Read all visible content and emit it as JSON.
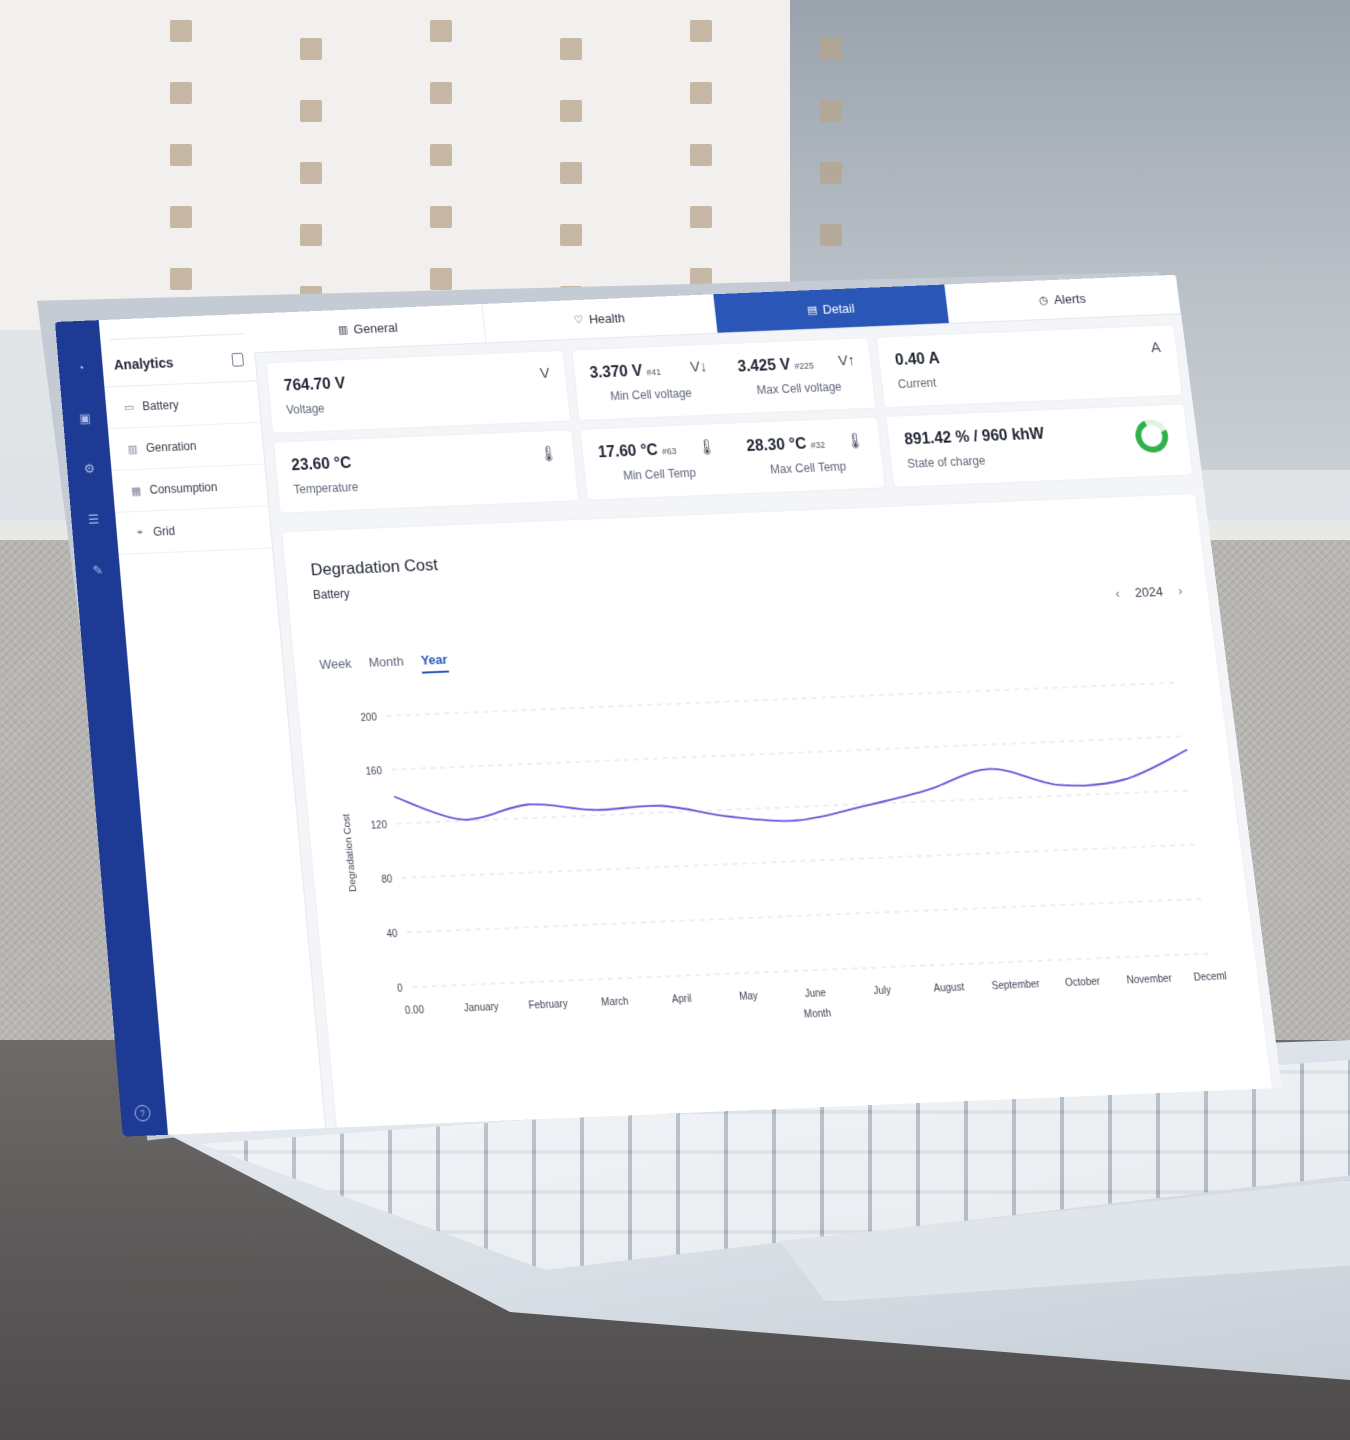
{
  "sidebar": {
    "title": "Analytics",
    "items": [
      {
        "label": "Battery",
        "icon": "battery-icon"
      },
      {
        "label": "Genration",
        "icon": "generation-icon"
      },
      {
        "label": "Consumption",
        "icon": "consumption-icon"
      },
      {
        "label": "Grid",
        "icon": "grid-tower-icon"
      }
    ]
  },
  "tabs": [
    {
      "label": "General",
      "icon": "chart-icon"
    },
    {
      "label": "Health",
      "icon": "health-icon"
    },
    {
      "label": "Detail",
      "icon": "document-icon",
      "active": true
    },
    {
      "label": "Alerts",
      "icon": "clock-icon"
    }
  ],
  "metrics": {
    "voltage": {
      "value": "764.70 V",
      "label": "Voltage",
      "unit": "V"
    },
    "min_cell_voltage": {
      "value": "3.370 V",
      "tag": "#41",
      "label": "Min Cell voltage",
      "unit": "V↓"
    },
    "max_cell_voltage": {
      "value": "3.425 V",
      "tag": "#225",
      "label": "Max Cell voltage",
      "unit": "V↑"
    },
    "current": {
      "value": "0.40 A",
      "label": "Current",
      "unit": "A"
    },
    "temperature": {
      "value": "23.60 °C",
      "label": "Temperature"
    },
    "min_cell_temp": {
      "value": "17.60 °C",
      "tag": "#63",
      "label": "Min Cell Temp"
    },
    "max_cell_temp": {
      "value": "28.30 °C",
      "tag": "#32",
      "label": "Max Cell Temp"
    },
    "state_of_charge": {
      "value": "891.42 % / 960 khW",
      "label": "State of charge",
      "ring_color": "#2db34a"
    }
  },
  "chart_header": {
    "title": "Degradation Cost",
    "subtitle": "Battery",
    "year": "2024",
    "ranges": [
      "Week",
      "Month",
      "Year"
    ],
    "active_range": "Year"
  },
  "colors": {
    "accent": "#2a57b7",
    "rail": "#1d3a94",
    "line": "#6a4fd8"
  },
  "chart_data": {
    "type": "line",
    "x": [
      "0.00",
      "January",
      "February",
      "March",
      "April",
      "May",
      "June",
      "July",
      "August",
      "September",
      "October",
      "November",
      "December"
    ],
    "series": [
      {
        "values": [
          140,
          121,
          130,
          124,
          125,
          115,
          110,
          118,
          128,
          142,
          128,
          130,
          150
        ]
      }
    ],
    "yticks": [
      0,
      40,
      80,
      120,
      160,
      200
    ],
    "ylim": [
      0,
      200
    ],
    "xlabel": "Month",
    "ylabel": "Degradation Cost",
    "grid": true
  }
}
